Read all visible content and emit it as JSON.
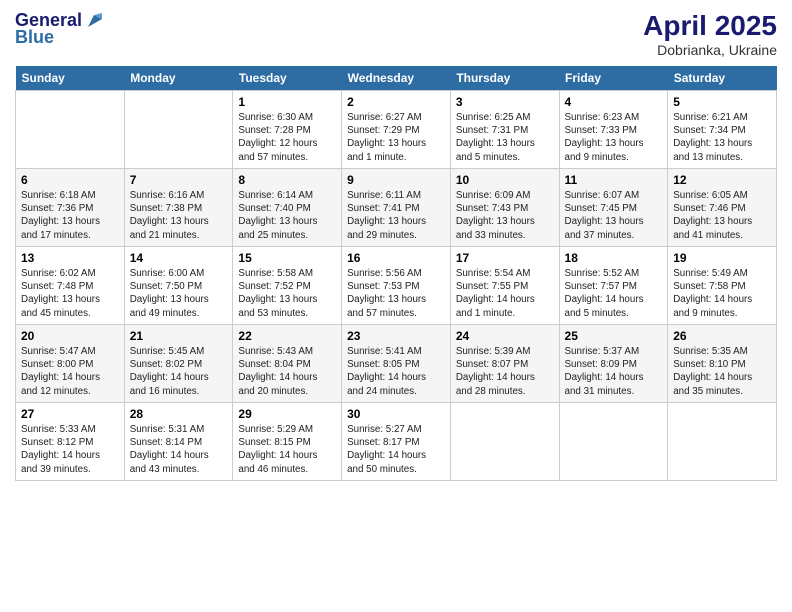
{
  "header": {
    "logo_line1": "General",
    "logo_line2": "Blue",
    "title": "April 2025",
    "subtitle": "Dobrianka, Ukraine"
  },
  "columns": [
    "Sunday",
    "Monday",
    "Tuesday",
    "Wednesday",
    "Thursday",
    "Friday",
    "Saturday"
  ],
  "weeks": [
    [
      {
        "day": "",
        "sunrise": "",
        "sunset": "",
        "daylight": ""
      },
      {
        "day": "",
        "sunrise": "",
        "sunset": "",
        "daylight": ""
      },
      {
        "day": "1",
        "sunrise": "Sunrise: 6:30 AM",
        "sunset": "Sunset: 7:28 PM",
        "daylight": "Daylight: 12 hours and 57 minutes."
      },
      {
        "day": "2",
        "sunrise": "Sunrise: 6:27 AM",
        "sunset": "Sunset: 7:29 PM",
        "daylight": "Daylight: 13 hours and 1 minute."
      },
      {
        "day": "3",
        "sunrise": "Sunrise: 6:25 AM",
        "sunset": "Sunset: 7:31 PM",
        "daylight": "Daylight: 13 hours and 5 minutes."
      },
      {
        "day": "4",
        "sunrise": "Sunrise: 6:23 AM",
        "sunset": "Sunset: 7:33 PM",
        "daylight": "Daylight: 13 hours and 9 minutes."
      },
      {
        "day": "5",
        "sunrise": "Sunrise: 6:21 AM",
        "sunset": "Sunset: 7:34 PM",
        "daylight": "Daylight: 13 hours and 13 minutes."
      }
    ],
    [
      {
        "day": "6",
        "sunrise": "Sunrise: 6:18 AM",
        "sunset": "Sunset: 7:36 PM",
        "daylight": "Daylight: 13 hours and 17 minutes."
      },
      {
        "day": "7",
        "sunrise": "Sunrise: 6:16 AM",
        "sunset": "Sunset: 7:38 PM",
        "daylight": "Daylight: 13 hours and 21 minutes."
      },
      {
        "day": "8",
        "sunrise": "Sunrise: 6:14 AM",
        "sunset": "Sunset: 7:40 PM",
        "daylight": "Daylight: 13 hours and 25 minutes."
      },
      {
        "day": "9",
        "sunrise": "Sunrise: 6:11 AM",
        "sunset": "Sunset: 7:41 PM",
        "daylight": "Daylight: 13 hours and 29 minutes."
      },
      {
        "day": "10",
        "sunrise": "Sunrise: 6:09 AM",
        "sunset": "Sunset: 7:43 PM",
        "daylight": "Daylight: 13 hours and 33 minutes."
      },
      {
        "day": "11",
        "sunrise": "Sunrise: 6:07 AM",
        "sunset": "Sunset: 7:45 PM",
        "daylight": "Daylight: 13 hours and 37 minutes."
      },
      {
        "day": "12",
        "sunrise": "Sunrise: 6:05 AM",
        "sunset": "Sunset: 7:46 PM",
        "daylight": "Daylight: 13 hours and 41 minutes."
      }
    ],
    [
      {
        "day": "13",
        "sunrise": "Sunrise: 6:02 AM",
        "sunset": "Sunset: 7:48 PM",
        "daylight": "Daylight: 13 hours and 45 minutes."
      },
      {
        "day": "14",
        "sunrise": "Sunrise: 6:00 AM",
        "sunset": "Sunset: 7:50 PM",
        "daylight": "Daylight: 13 hours and 49 minutes."
      },
      {
        "day": "15",
        "sunrise": "Sunrise: 5:58 AM",
        "sunset": "Sunset: 7:52 PM",
        "daylight": "Daylight: 13 hours and 53 minutes."
      },
      {
        "day": "16",
        "sunrise": "Sunrise: 5:56 AM",
        "sunset": "Sunset: 7:53 PM",
        "daylight": "Daylight: 13 hours and 57 minutes."
      },
      {
        "day": "17",
        "sunrise": "Sunrise: 5:54 AM",
        "sunset": "Sunset: 7:55 PM",
        "daylight": "Daylight: 14 hours and 1 minute."
      },
      {
        "day": "18",
        "sunrise": "Sunrise: 5:52 AM",
        "sunset": "Sunset: 7:57 PM",
        "daylight": "Daylight: 14 hours and 5 minutes."
      },
      {
        "day": "19",
        "sunrise": "Sunrise: 5:49 AM",
        "sunset": "Sunset: 7:58 PM",
        "daylight": "Daylight: 14 hours and 9 minutes."
      }
    ],
    [
      {
        "day": "20",
        "sunrise": "Sunrise: 5:47 AM",
        "sunset": "Sunset: 8:00 PM",
        "daylight": "Daylight: 14 hours and 12 minutes."
      },
      {
        "day": "21",
        "sunrise": "Sunrise: 5:45 AM",
        "sunset": "Sunset: 8:02 PM",
        "daylight": "Daylight: 14 hours and 16 minutes."
      },
      {
        "day": "22",
        "sunrise": "Sunrise: 5:43 AM",
        "sunset": "Sunset: 8:04 PM",
        "daylight": "Daylight: 14 hours and 20 minutes."
      },
      {
        "day": "23",
        "sunrise": "Sunrise: 5:41 AM",
        "sunset": "Sunset: 8:05 PM",
        "daylight": "Daylight: 14 hours and 24 minutes."
      },
      {
        "day": "24",
        "sunrise": "Sunrise: 5:39 AM",
        "sunset": "Sunset: 8:07 PM",
        "daylight": "Daylight: 14 hours and 28 minutes."
      },
      {
        "day": "25",
        "sunrise": "Sunrise: 5:37 AM",
        "sunset": "Sunset: 8:09 PM",
        "daylight": "Daylight: 14 hours and 31 minutes."
      },
      {
        "day": "26",
        "sunrise": "Sunrise: 5:35 AM",
        "sunset": "Sunset: 8:10 PM",
        "daylight": "Daylight: 14 hours and 35 minutes."
      }
    ],
    [
      {
        "day": "27",
        "sunrise": "Sunrise: 5:33 AM",
        "sunset": "Sunset: 8:12 PM",
        "daylight": "Daylight: 14 hours and 39 minutes."
      },
      {
        "day": "28",
        "sunrise": "Sunrise: 5:31 AM",
        "sunset": "Sunset: 8:14 PM",
        "daylight": "Daylight: 14 hours and 43 minutes."
      },
      {
        "day": "29",
        "sunrise": "Sunrise: 5:29 AM",
        "sunset": "Sunset: 8:15 PM",
        "daylight": "Daylight: 14 hours and 46 minutes."
      },
      {
        "day": "30",
        "sunrise": "Sunrise: 5:27 AM",
        "sunset": "Sunset: 8:17 PM",
        "daylight": "Daylight: 14 hours and 50 minutes."
      },
      {
        "day": "",
        "sunrise": "",
        "sunset": "",
        "daylight": ""
      },
      {
        "day": "",
        "sunrise": "",
        "sunset": "",
        "daylight": ""
      },
      {
        "day": "",
        "sunrise": "",
        "sunset": "",
        "daylight": ""
      }
    ]
  ]
}
